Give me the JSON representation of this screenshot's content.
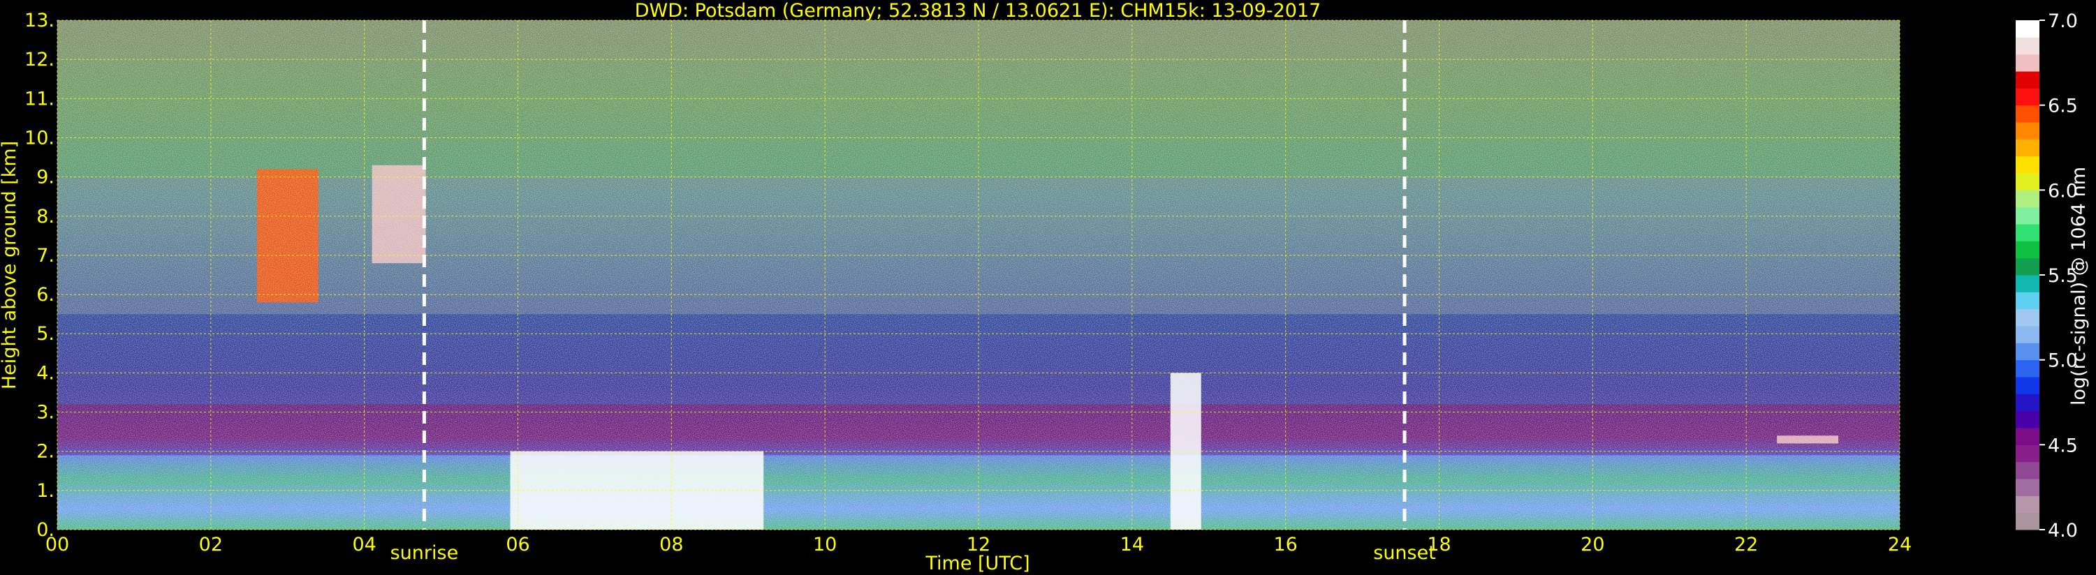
{
  "chart_data": {
    "type": "heatmap",
    "title": "DWD: Potsdam (Germany; 52.3813 N / 13.0621 E):    CHM15k: 13-09-2017",
    "xlabel": "Time [UTC]",
    "ylabel": "Height above ground [km]",
    "xlim": [
      0,
      24
    ],
    "ylim": [
      0,
      13
    ],
    "x_ticks": [
      0,
      2,
      4,
      6,
      8,
      10,
      12,
      14,
      16,
      18,
      20,
      22,
      24
    ],
    "x_tick_labels": [
      "00",
      "02",
      "04",
      "06",
      "08",
      "10",
      "12",
      "14",
      "16",
      "18",
      "20",
      "22",
      "24"
    ],
    "y_ticks": [
      0,
      1,
      2,
      3,
      4,
      5,
      6,
      7,
      8,
      9,
      10,
      11,
      12,
      13
    ],
    "y_tick_labels": [
      "0.",
      "1.",
      "2.",
      "3.",
      "4.",
      "5.",
      "6.",
      "7.",
      "8.",
      "9.",
      "10.",
      "11.",
      "12.",
      "13."
    ],
    "grid": true,
    "grid_color": "#ffff00",
    "annotations": [
      {
        "label": "sunrise",
        "x": 4.78
      },
      {
        "label": "sunset",
        "x": 17.55
      }
    ],
    "colorbar": {
      "label": "log(rc-signal) @ 1064 nm",
      "range": [
        4.0,
        7.0
      ],
      "tick_values": [
        4.0,
        4.5,
        5.0,
        5.5,
        6.0,
        6.5,
        7.0
      ],
      "tick_labels": [
        "4.0",
        "4.5",
        "5.0",
        "5.5",
        "6.0",
        "6.5",
        "7.0"
      ],
      "colors": [
        "#a8949c",
        "#b696a8",
        "#a06ea0",
        "#904894",
        "#88208c",
        "#7c0c88",
        "#4a00a8",
        "#2416c8",
        "#1038e8",
        "#2a64f0",
        "#5a90f0",
        "#8cb8f0",
        "#a0c8f0",
        "#60d0f0",
        "#10b8b0",
        "#10a050",
        "#10c040",
        "#30e070",
        "#80f0a0",
        "#b0f080",
        "#e0f020",
        "#ffe000",
        "#ffb000",
        "#ff8800",
        "#ff5000",
        "#ff1010",
        "#e00000",
        "#f0c0c0",
        "#f0e0e0",
        "#ffffff"
      ]
    },
    "background_layer": {
      "description_values": [
        {
          "height_km": [
            0,
            1.9
          ],
          "log_signal": 5.2
        },
        {
          "height_km": [
            1.9,
            3.2
          ],
          "log_signal": 4.6
        },
        {
          "height_km": [
            3.2,
            5.5
          ],
          "log_signal": 4.9
        },
        {
          "height_km": [
            5.5,
            9.0
          ],
          "log_signal": 5.2
        },
        {
          "height_km": [
            9.0,
            13.0
          ],
          "log_signal": 5.8
        }
      ]
    },
    "cloud_features": [
      {
        "t": [
          2.6,
          3.4
        ],
        "h": [
          5.8,
          9.2
        ],
        "log_signal": 6.4
      },
      {
        "t": [
          4.1,
          4.8
        ],
        "h": [
          6.8,
          9.3
        ],
        "log_signal": 6.8
      },
      {
        "t": [
          5.9,
          9.2
        ],
        "h": [
          0,
          2.0
        ],
        "log_signal": 7.0
      },
      {
        "t": [
          14.5,
          14.9
        ],
        "h": [
          0,
          4.0
        ],
        "log_signal": 7.0
      },
      {
        "t": [
          22.4,
          23.2
        ],
        "h": [
          2.2,
          2.4
        ],
        "log_signal": 6.8
      }
    ]
  }
}
